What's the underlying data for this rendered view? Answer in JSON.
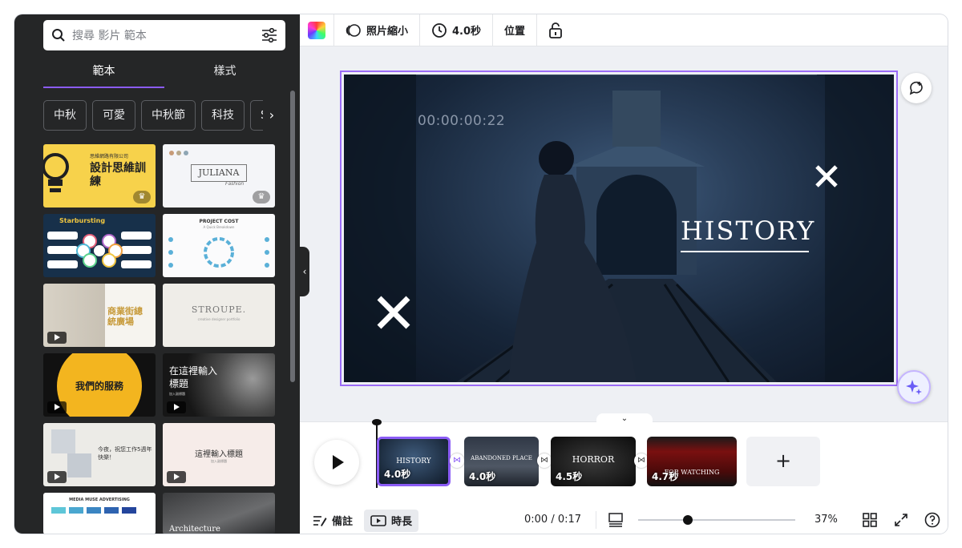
{
  "search": {
    "placeholder": "搜尋 影片 範本"
  },
  "tabs": [
    {
      "label": "範本"
    },
    {
      "label": "樣式"
    }
  ],
  "chips": [
    "中秋",
    "可愛",
    "中秋節",
    "科技",
    "So"
  ],
  "templates": [
    {
      "title": "設計思維訓練",
      "company": "思維網路有限公司",
      "badge": "crown-icon"
    },
    {
      "title": "JULIANA",
      "subtitle": "Fashion",
      "badge": "crown-icon"
    },
    {
      "title": "Starbursting"
    },
    {
      "title": "PROJECT COST",
      "subtitle": "A Quick Breakdown"
    },
    {
      "title": "商業街總統廣場",
      "badge": "play-icon"
    },
    {
      "title": "STROUPE.",
      "subtitle": "creative designer portfolio"
    },
    {
      "title": "我們的服務",
      "badge": "play-icon"
    },
    {
      "title": "在這裡輸入標題",
      "subtitle": "加入副標題",
      "badge": "play-icon"
    },
    {
      "title": "今夜，祝您工作5週年快樂！",
      "badge": "play-icon"
    },
    {
      "title": "這裡輸入標題",
      "subtitle": "加入副標題",
      "badge": "play-icon"
    },
    {
      "title": "MEDIA MUSE ADVERTISING"
    },
    {
      "title": "Architecture"
    }
  ],
  "toolbar": {
    "photo_shrink": "照片縮小",
    "duration": "4.0秒",
    "position": "位置"
  },
  "canvas": {
    "timecode": "00:00:00:22",
    "title": "HISTORY"
  },
  "timeline": {
    "clips": [
      {
        "duration": "4.0秒",
        "label": "HISTORY",
        "selected": true
      },
      {
        "duration": "4.0秒",
        "label": "ABANDONED PLACE"
      },
      {
        "duration": "4.5秒",
        "label": "HORROR"
      },
      {
        "duration": "4.7秒",
        "label": "FOR WATCHING"
      }
    ],
    "add_label": "+"
  },
  "bottombar": {
    "notes": "備註",
    "duration": "時長",
    "time": "0:00 / 0:17",
    "zoom_percent": "37%",
    "zoom_level": 0.37
  },
  "colors": {
    "accent": "#8b5cf6",
    "panel": "#252627"
  }
}
